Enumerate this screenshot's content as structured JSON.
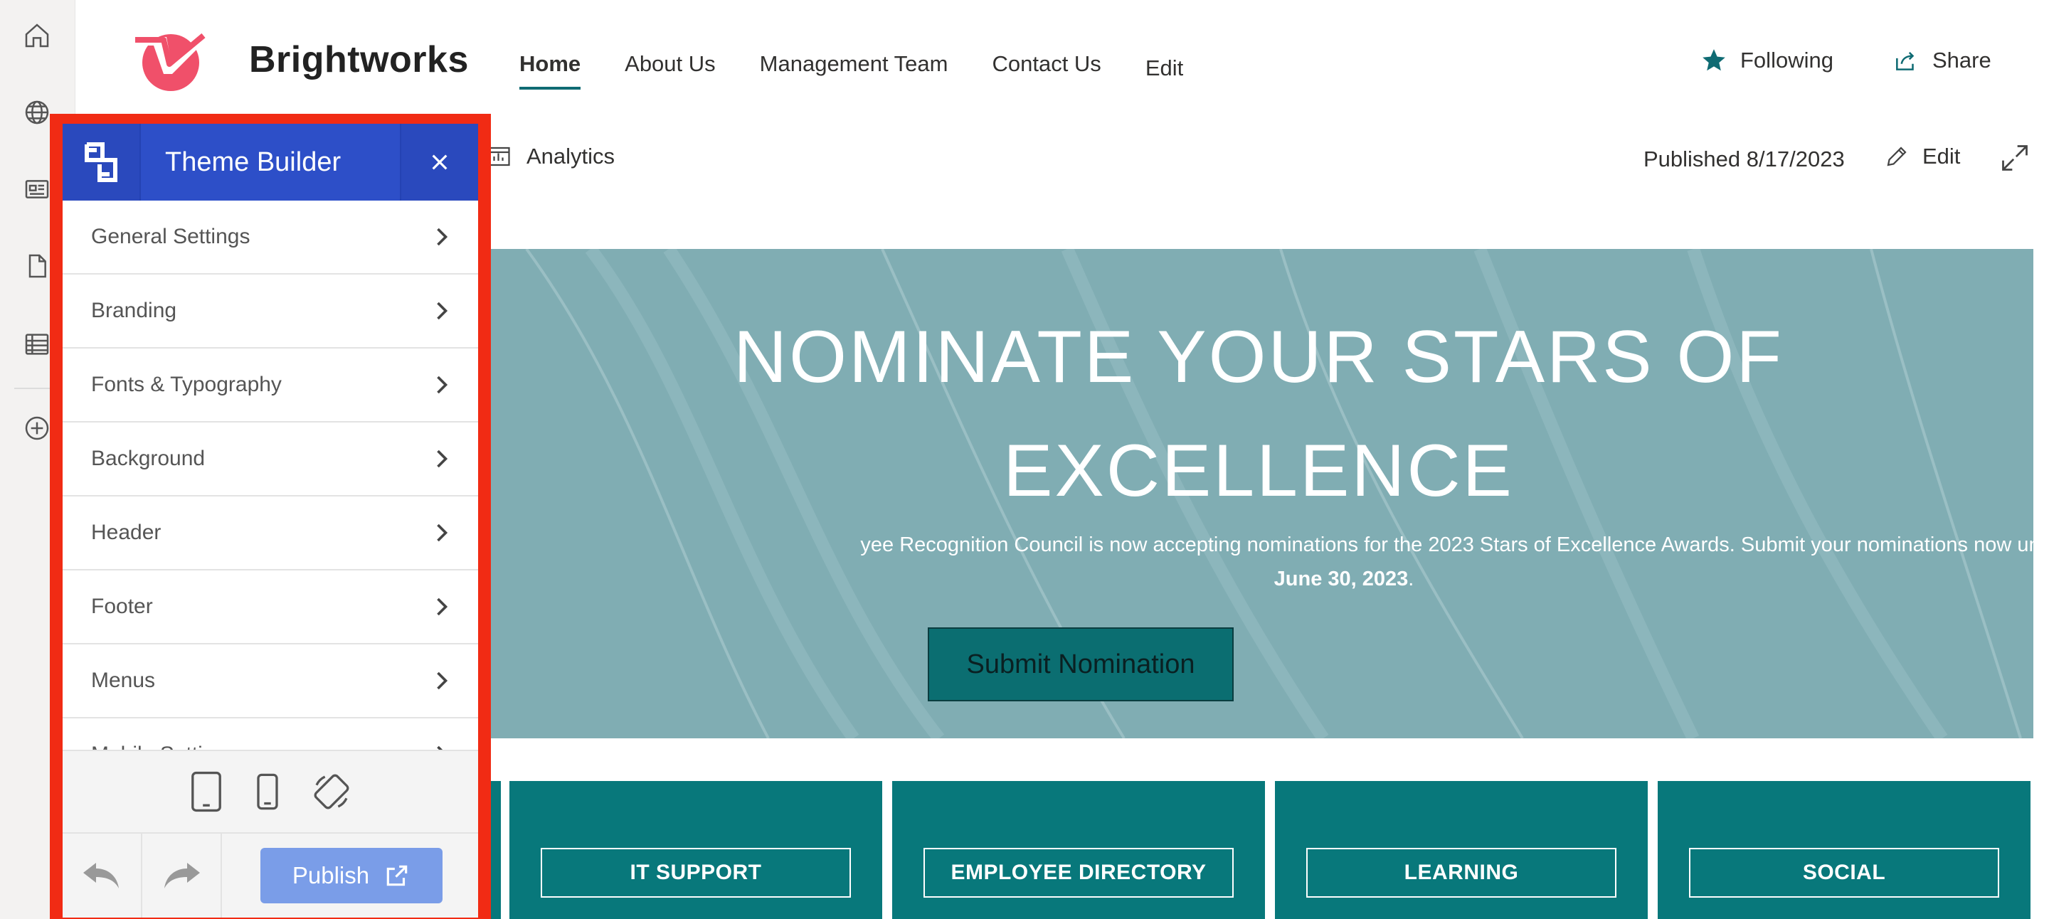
{
  "site": {
    "title": "Brightworks",
    "nav": [
      "Home",
      "About Us",
      "Management Team",
      "Contact Us",
      "Edit"
    ],
    "following_label": "Following",
    "share_label": "Share"
  },
  "commandbar": {
    "analytics_label": "Analytics",
    "published_label": "Published 8/17/2023",
    "edit_label": "Edit"
  },
  "hero": {
    "title_line1": "NOMINATE YOUR STARS OF",
    "title_line2": "EXCELLENCE",
    "description": "yee Recognition Council is now accepting nominations for the 2023 Stars of Excellence Awards. Submit your nominations now until",
    "deadline": "June 30, 2023",
    "deadline_suffix": ".",
    "button_label": "Submit Nomination"
  },
  "tiles": [
    "IT SUPPORT",
    "EMPLOYEE DIRECTORY",
    "LEARNING",
    "SOCIAL"
  ],
  "theme_builder": {
    "title": "Theme Builder",
    "items": [
      "General Settings",
      "Branding",
      "Fonts & Typography",
      "Background",
      "Header",
      "Footer",
      "Menus",
      "Mobile Settings"
    ],
    "publish_label": "Publish"
  },
  "colors": {
    "accent_teal": "#08787b",
    "hero_bg": "#80adb3",
    "panel_blue": "#2d4fc8",
    "publish_blue": "#7a9de8",
    "highlight_red": "#f12b14",
    "logo_pink": "#f0506a"
  },
  "icons": {
    "rail": [
      "home-icon",
      "globe-icon",
      "news-icon",
      "page-icon",
      "list-icon",
      "add-circle-icon"
    ],
    "devices": [
      "tablet-icon",
      "phone-icon",
      "rotate-icon"
    ]
  }
}
